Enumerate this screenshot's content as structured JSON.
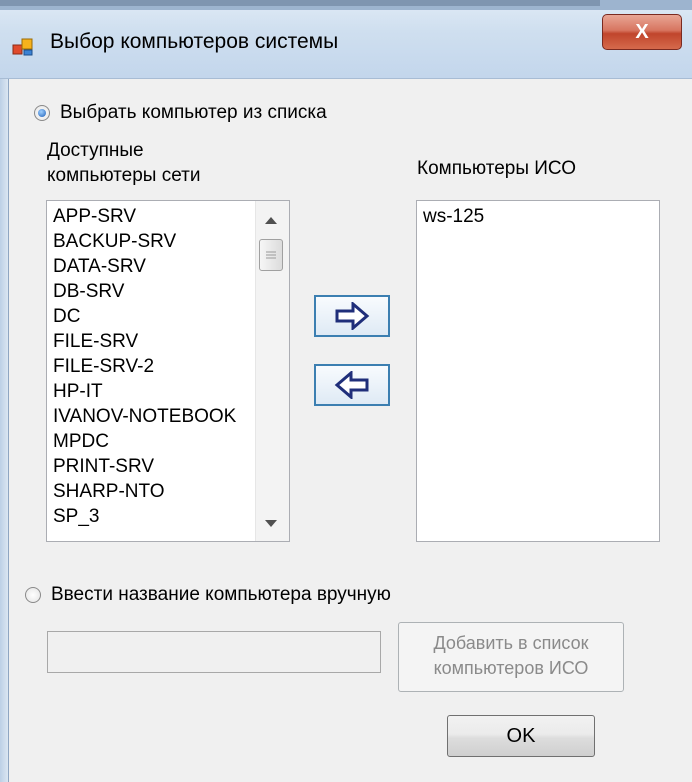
{
  "window": {
    "title": "Выбор компьютеров системы",
    "close_symbol": "X"
  },
  "select_from_list": {
    "radio_label": "Выбрать компьютер из списка",
    "checked": true
  },
  "available": {
    "header": "Доступные\nкомпьютеры сети",
    "items": [
      "APP-SRV",
      "BACKUP-SRV",
      "DATA-SRV",
      "DB-SRV",
      "DC",
      "FILE-SRV",
      "FILE-SRV-2",
      "HP-IT",
      "IVANOV-NOTEBOOK",
      "MPDC",
      "PRINT-SRV",
      "SHARP-NTO",
      "SP_3"
    ]
  },
  "iso": {
    "header": "Компьютеры ИСО",
    "items": [
      "ws-125"
    ]
  },
  "move_buttons": {
    "add_icon": "right-arrow-icon",
    "remove_icon": "left-arrow-icon",
    "arrow_color": "#2a3f8f"
  },
  "manual": {
    "radio_label": "Ввести название компьютера вручную",
    "checked": false,
    "input_value": "",
    "add_button": "Добавить в список\nкомпьютеров ИСО"
  },
  "ok_button": "OK"
}
